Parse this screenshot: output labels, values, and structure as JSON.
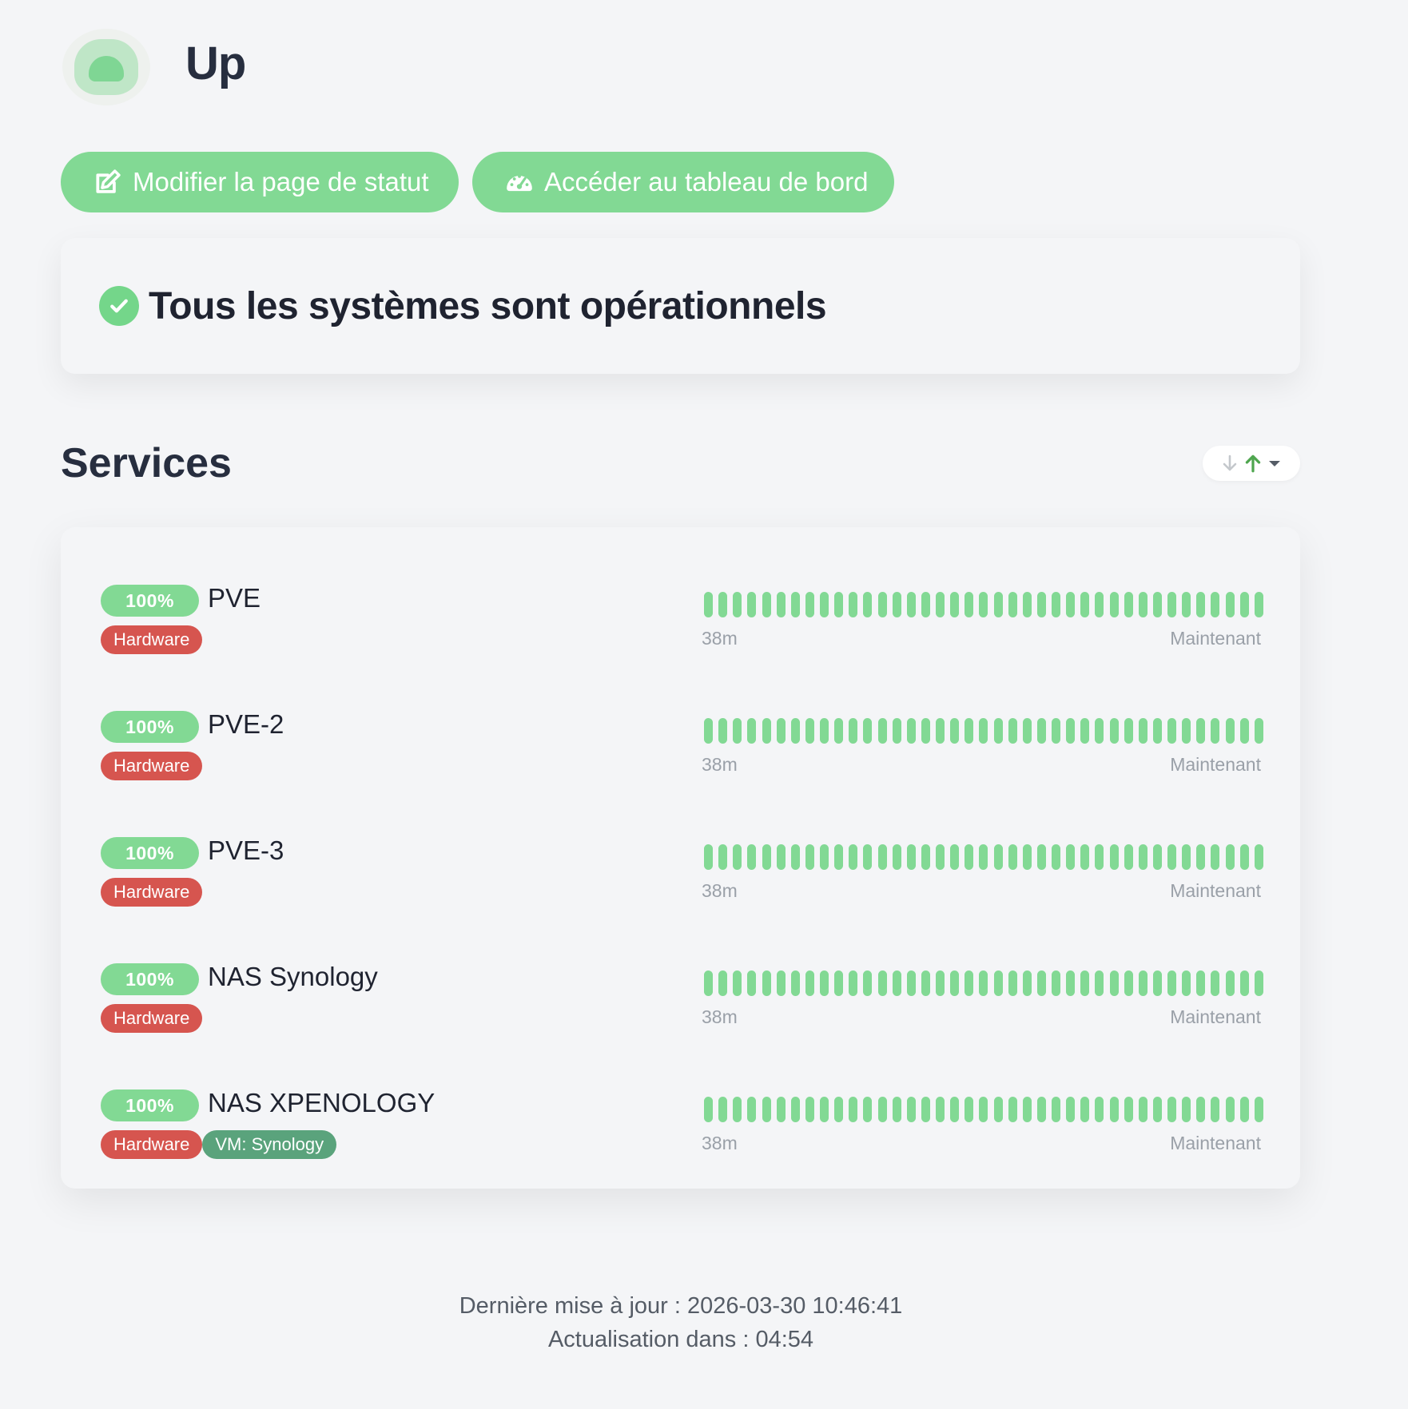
{
  "app": {
    "title": "Up"
  },
  "buttons": {
    "edit_status_page": "Modifier la page de statut",
    "go_to_dashboard": "Accéder au tableau de bord"
  },
  "overall_status": {
    "text": "Tous les systèmes sont opérationnels",
    "state": "operational"
  },
  "services_section": {
    "title": "Services",
    "sort_icons": [
      "arrow-down-icon",
      "arrow-up-icon",
      "caret-down-icon"
    ]
  },
  "services": [
    {
      "uptime": "100%",
      "name": "PVE",
      "tags": [
        {
          "label": "Hardware",
          "color": "#d6554f"
        }
      ],
      "time_start": "38m",
      "time_end": "Maintenant",
      "beats": 39
    },
    {
      "uptime": "100%",
      "name": "PVE-2",
      "tags": [
        {
          "label": "Hardware",
          "color": "#d6554f"
        }
      ],
      "time_start": "38m",
      "time_end": "Maintenant",
      "beats": 39
    },
    {
      "uptime": "100%",
      "name": "PVE-3",
      "tags": [
        {
          "label": "Hardware",
          "color": "#d6554f"
        }
      ],
      "time_start": "38m",
      "time_end": "Maintenant",
      "beats": 39
    },
    {
      "uptime": "100%",
      "name": "NAS Synology",
      "tags": [
        {
          "label": "Hardware",
          "color": "#d6554f"
        }
      ],
      "time_start": "38m",
      "time_end": "Maintenant",
      "beats": 39
    },
    {
      "uptime": "100%",
      "name": "NAS XPENOLOGY",
      "tags": [
        {
          "label": "Hardware",
          "color": "#d6554f"
        },
        {
          "label": "VM: Synology",
          "color": "#5aa37c"
        }
      ],
      "time_start": "38m",
      "time_end": "Maintenant",
      "beats": 39
    }
  ],
  "footer": {
    "last_update": "Dernière mise à jour : 2026-03-30 10:46:41",
    "refresh": "Actualisation dans : 04:54"
  },
  "colors": {
    "accent": "#82d994",
    "up": "#82d994",
    "tag_hardware": "#d6554f",
    "tag_vm": "#5aa37c"
  }
}
